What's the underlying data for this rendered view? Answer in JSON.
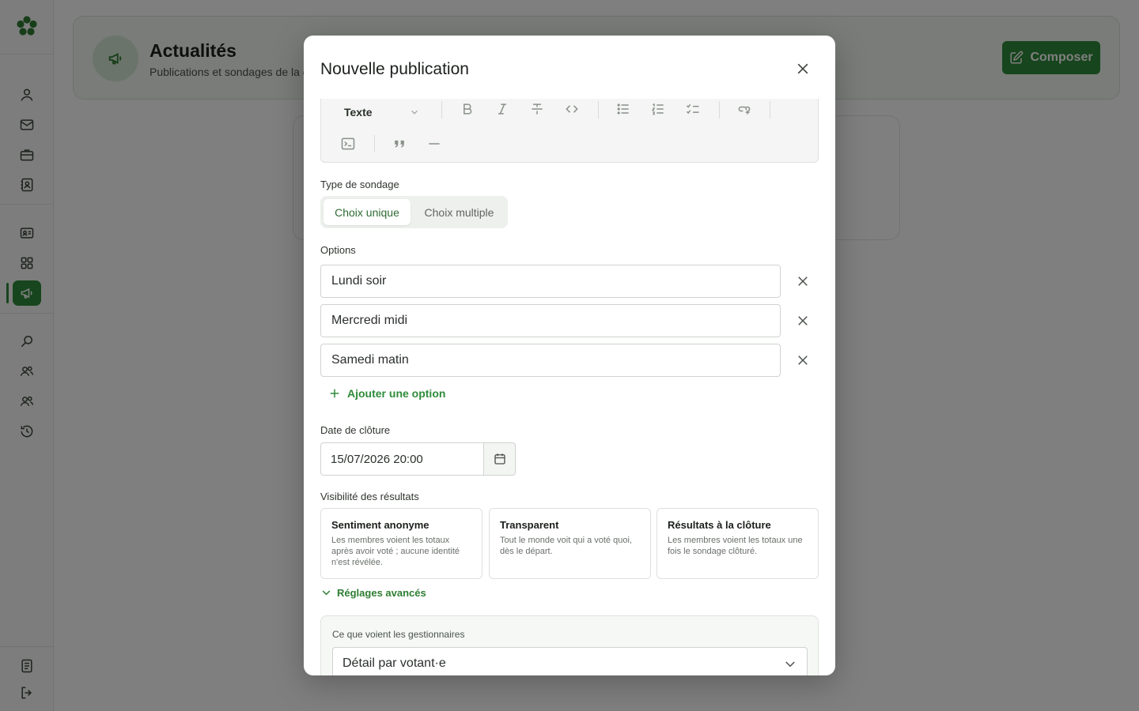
{
  "app": {
    "header": {
      "title": "Actualités",
      "subtitle": "Publications et sondages de la c",
      "compose_label": "Composer"
    },
    "sidebar": {
      "items": [
        "user-icon",
        "mail-icon",
        "briefcase-icon",
        "contact-book-icon",
        "id-card-icon",
        "grid-icon",
        "megaphone-icon",
        "search-icon",
        "team-icon",
        "group-icon",
        "history-icon",
        "document-icon",
        "logout-icon"
      ],
      "active": "megaphone-icon"
    }
  },
  "modal": {
    "title": "Nouvelle publication",
    "toolbar": {
      "format_label": "Texte",
      "buttons": [
        "bold-icon",
        "italic-icon",
        "strikethrough-icon",
        "code-icon",
        "bullet-list-icon",
        "ordered-list-icon",
        "checklist-icon",
        "link-icon",
        "code-block-icon",
        "quote-icon",
        "horizontal-rule-icon"
      ]
    },
    "poll_type": {
      "label": "Type de sondage",
      "options": [
        "Choix unique",
        "Choix multiple"
      ],
      "selected": "Choix unique"
    },
    "options": {
      "label": "Options",
      "items": [
        "Lundi soir",
        "Mercredi midi",
        "Samedi matin"
      ],
      "add_label": "Ajouter une option"
    },
    "closing_date": {
      "label": "Date de clôture",
      "value": "15/07/2026 20:00"
    },
    "visibility": {
      "label": "Visibilité des résultats",
      "cards": [
        {
          "title": "Sentiment anonyme",
          "desc": "Les membres voient les totaux après avoir voté ; aucune identité n'est révélée."
        },
        {
          "title": "Transparent",
          "desc": "Tout le monde voit qui a voté quoi, dès le départ."
        },
        {
          "title": "Résultats à la clôture",
          "desc": "Les membres voient les totaux une fois le sondage clôturé."
        }
      ]
    },
    "advanced": {
      "toggle_label": "Réglages avancés",
      "managers_label": "Ce que voient les gestionnaires",
      "managers_value": "Détail par votant·e"
    }
  },
  "colors": {
    "accent": "#2e8b3a",
    "accent_text": "#2e7d32",
    "overlay": "rgba(0,0,0,0.5)"
  }
}
